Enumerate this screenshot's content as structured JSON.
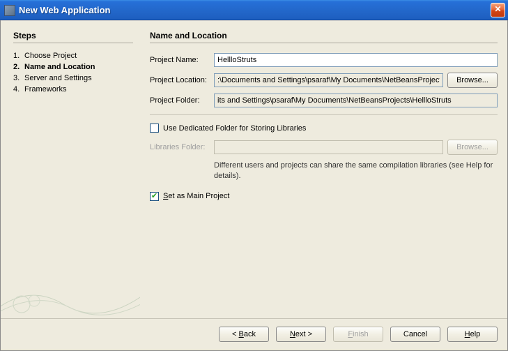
{
  "window": {
    "title": "New Web Application"
  },
  "steps": {
    "heading": "Steps",
    "items": [
      {
        "num": "1.",
        "label": "Choose Project"
      },
      {
        "num": "2.",
        "label": "Name and Location"
      },
      {
        "num": "3.",
        "label": "Server and Settings"
      },
      {
        "num": "4.",
        "label": "Frameworks"
      }
    ],
    "currentIndex": 1
  },
  "panel": {
    "heading": "Name and Location",
    "projectNameLabel": "Project Name:",
    "projectNameValue": "HellloStruts",
    "projectLocationLabel": "Project Location:",
    "projectLocationValue": ":\\Documents and Settings\\psaraf\\My Documents\\NetBeansProjects",
    "browseLabel": "Browse...",
    "projectFolderLabel": "Project Folder:",
    "projectFolderValue": "its and Settings\\psaraf\\My Documents\\NetBeansProjects\\HellloStruts",
    "dedicatedFolderLabel": "Use Dedicated Folder for Storing Libraries",
    "dedicatedFolderChecked": false,
    "librariesFolderLabel": "Libraries Folder:",
    "librariesFolderValue": "",
    "browse2Label": "Browse...",
    "hintText": "Different users and projects can share the same compilation libraries (see Help for details).",
    "setMainLabelPre": "S",
    "setMainLabelPost": "et as Main Project",
    "setMainChecked": true
  },
  "buttons": {
    "backPre": "< ",
    "backU": "B",
    "backPost": "ack",
    "nextPre": "",
    "nextU": "N",
    "nextPost": "ext >",
    "finishPre": "",
    "finishU": "F",
    "finishPost": "inish",
    "cancel": "Cancel",
    "helpPre": "",
    "helpU": "H",
    "helpPost": "elp"
  }
}
